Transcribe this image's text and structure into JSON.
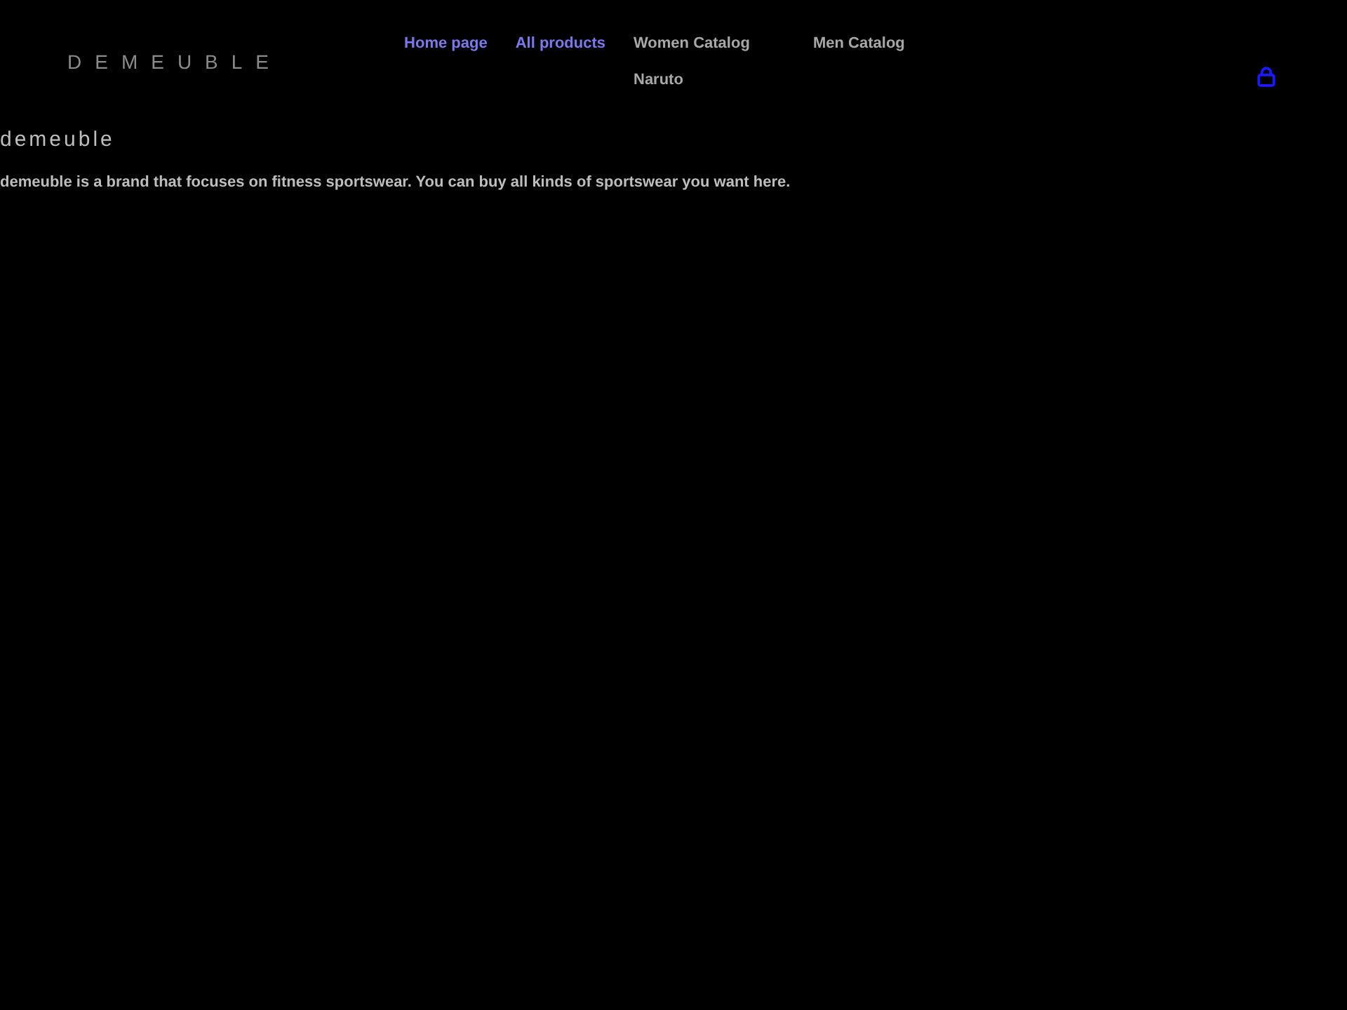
{
  "header": {
    "logo": "DEMEUBLE",
    "nav": [
      {
        "label": "Home page",
        "visited": true
      },
      {
        "label": "All products",
        "visited": true
      },
      {
        "label": "Women Catalog",
        "visited": false,
        "children": [
          {
            "label": "Naruto",
            "visited": false
          }
        ]
      },
      {
        "label": "Men Catalog",
        "visited": false
      }
    ]
  },
  "intro": {
    "heading": "demeuble",
    "text": "demeuble is a brand that focuses on fitness sportswear. You can buy all kinds of sportswear you want here."
  }
}
